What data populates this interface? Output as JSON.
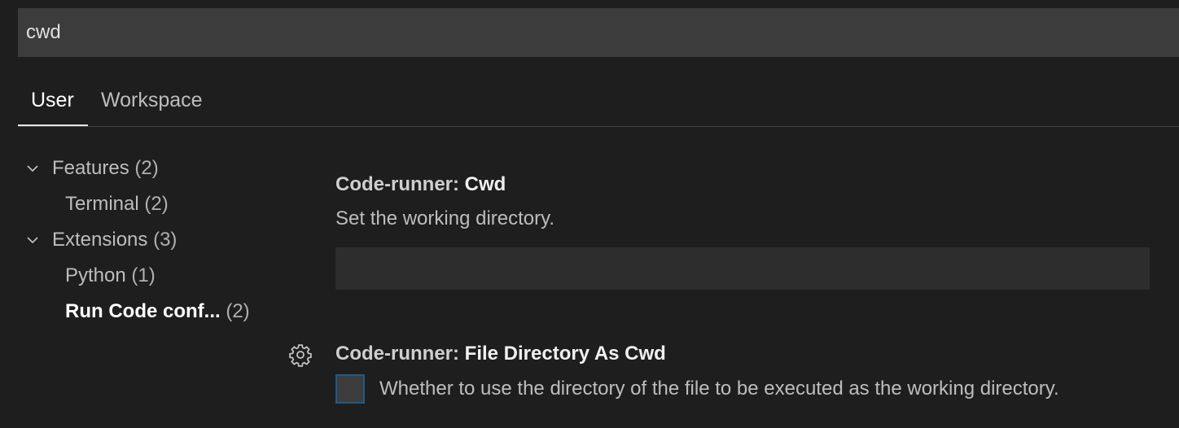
{
  "search": {
    "value": "cwd"
  },
  "tabs": [
    {
      "label": "User",
      "active": true
    },
    {
      "label": "Workspace",
      "active": false
    }
  ],
  "toc": [
    {
      "name": "Features",
      "count": "(2)",
      "level": 0,
      "expanded": true,
      "selected": false
    },
    {
      "name": "Terminal",
      "count": "(2)",
      "level": 1,
      "selected": false
    },
    {
      "name": "Extensions",
      "count": "(3)",
      "level": 0,
      "expanded": true,
      "selected": false
    },
    {
      "name": "Python",
      "count": "(1)",
      "level": 1,
      "selected": false
    },
    {
      "name": "Run Code conf...",
      "count": "(2)",
      "level": 1,
      "selected": true
    }
  ],
  "settings": [
    {
      "category": "Code-runner: ",
      "key": "Cwd",
      "description": "Set the working directory.",
      "value": ""
    },
    {
      "category": "Code-runner: ",
      "key": "File Directory As Cwd",
      "description": "Whether to use the directory of the file to be executed as the working directory.",
      "checked": false
    }
  ],
  "icons": {
    "chevron": "chevron-down-icon",
    "gear": "gear-icon"
  },
  "colors": {
    "background": "#1e1e1e",
    "input_background": "#3c3c3c",
    "checkbox_border": "#1f5a8a"
  }
}
